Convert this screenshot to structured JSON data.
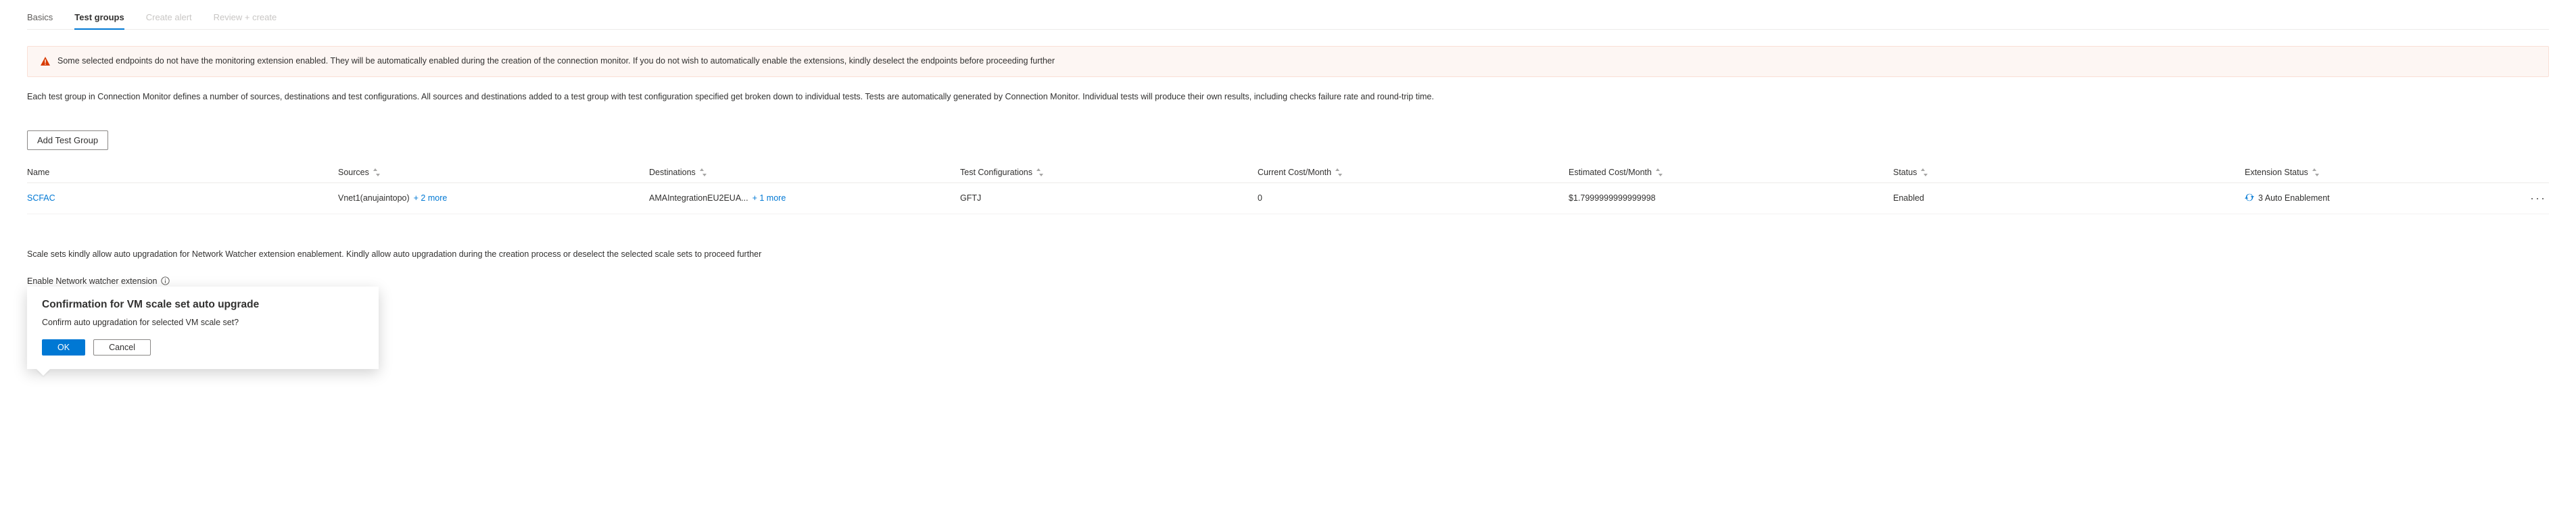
{
  "tabs": {
    "basics": "Basics",
    "test_groups": "Test groups",
    "create_alert": "Create alert",
    "review_create": "Review + create"
  },
  "banner": {
    "text": "Some selected endpoints do not have the monitoring extension enabled. They will be automatically enabled during the creation of the connection monitor. If you do not wish to automatically enable the extensions, kindly deselect the endpoints before proceeding further"
  },
  "description": "Each test group in Connection Monitor defines a number of sources, destinations and test configurations. All sources and destinations added to a test group with test configuration specified get broken down to individual tests. Tests are automatically generated by Connection Monitor. Individual tests will produce their own results, including checks failure rate and round-trip time.",
  "add_button": "Add Test Group",
  "columns": {
    "name": "Name",
    "sources": "Sources",
    "destinations": "Destinations",
    "test_configs": "Test Configurations",
    "current_cost": "Current Cost/Month",
    "estimated_cost": "Estimated Cost/Month",
    "status": "Status",
    "extension_status": "Extension Status"
  },
  "rows": [
    {
      "name": "SCFAC",
      "sources_main": "Vnet1(anujaintopo)",
      "sources_more": "+ 2 more",
      "destinations_main": "AMAIntegrationEU2EUA...",
      "destinations_more": "+ 1 more",
      "test_configs": "GFTJ",
      "current_cost": "0",
      "estimated_cost": "$1.7999999999999998",
      "status": "Enabled",
      "extension_status": "3 Auto Enablement"
    }
  ],
  "note": "Scale sets kindly allow auto upgradation for Network Watcher extension enablement. Kindly allow auto upgradation during the creation process or deselect the selected scale sets to proceed further",
  "checkbox_label": "Enable Network watcher extension",
  "dialog": {
    "title": "Confirmation for VM scale set auto upgrade",
    "message": "Confirm auto upgradation for selected VM scale set?",
    "ok": "OK",
    "cancel": "Cancel"
  }
}
